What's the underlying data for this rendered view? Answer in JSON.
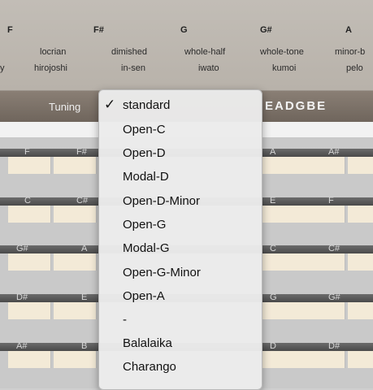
{
  "top_notes": [
    "F",
    "F#",
    "G",
    "G#",
    "A"
  ],
  "scales_row1": [
    "locrian",
    "dimished",
    "whole-half",
    "whole-tone",
    "minor-b"
  ],
  "scales_row2": [
    "y",
    "hirojoshi",
    "in-sen",
    "iwato",
    "kumoi",
    "pelo"
  ],
  "tuning": {
    "label": "Tuning",
    "value": "EADGBE"
  },
  "fret_rows": [
    [
      "F",
      "F#",
      "A",
      "A#"
    ],
    [
      "C",
      "C#",
      "E",
      "F"
    ],
    [
      "G#",
      "A",
      "C",
      "C#"
    ],
    [
      "D#",
      "E",
      "G",
      "G#"
    ],
    [
      "A#",
      "B",
      "D",
      "D#"
    ]
  ],
  "menu": {
    "selected": "standard",
    "items": [
      "standard",
      "Open-C",
      "Open-D",
      "Modal-D",
      "Open-D-Minor",
      "Open-G",
      "Modal-G",
      "Open-G-Minor",
      "Open-A",
      "-",
      "Balalaika",
      "Charango"
    ]
  }
}
